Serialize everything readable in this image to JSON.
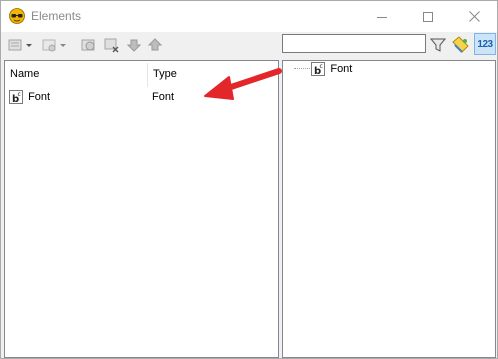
{
  "window": {
    "title": "Elements",
    "buttons": {
      "minimize": "minimize-icon",
      "maximize": "maximize-icon",
      "close": "close-icon"
    }
  },
  "toolbar": {
    "search_value": "",
    "icons": [
      "add-element-icon",
      "add-child-icon",
      "edit-element-icon",
      "delete-element-icon",
      "move-down-icon",
      "move-up-icon",
      "filter-icon",
      "clear-filter-icon",
      "sort-numeric-icon"
    ],
    "numeric_label": "123"
  },
  "list": {
    "columns": [
      "Name",
      "Type"
    ],
    "rows": [
      {
        "name": "Font",
        "type": "Font",
        "icon": "font-element-icon"
      }
    ]
  },
  "tree": {
    "nodes": [
      {
        "label": "Font",
        "icon": "font-element-icon"
      }
    ]
  },
  "colors": {
    "arrow": "#e3262a",
    "accent": "#cce4f7",
    "panel_border": "#828790"
  }
}
